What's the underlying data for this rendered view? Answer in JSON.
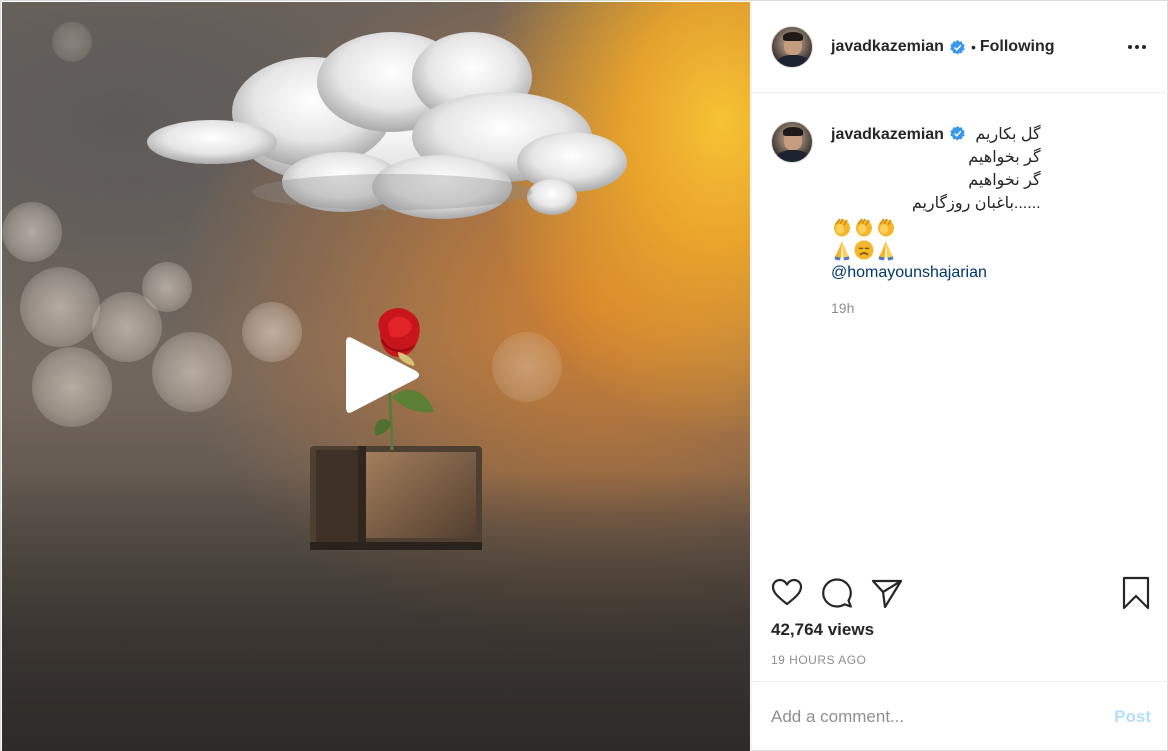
{
  "post": {
    "author": "javadkazemian",
    "verified": true,
    "follow_state": "Following",
    "separator": "•",
    "media": {
      "type": "video",
      "play_icon": "play-icon"
    },
    "caption": {
      "lines": [
        "گل بکاریم",
        "گر بخواهیم",
        "گر نخواهیم",
        "......باغبان روزگاریم"
      ],
      "emoji_rows": [
        [
          "clapping-hands",
          "clapping-hands",
          "clapping-hands"
        ],
        [
          "folded-hands",
          "disappointed-face",
          "folded-hands"
        ]
      ],
      "mention": "@homayounshajarian",
      "relative_time": "19h"
    },
    "actions": {
      "like_icon": "heart-icon",
      "comment_icon": "comment-icon",
      "share_icon": "paper-plane-icon",
      "save_icon": "bookmark-icon"
    },
    "views": "42,764 views",
    "timestamp": "19 HOURS AGO",
    "comment_box": {
      "placeholder": "Add a comment...",
      "post_label": "Post"
    },
    "colors": {
      "verified_blue": "#3897f0",
      "mention": "#00376b",
      "post_disabled": "#b2dffc",
      "muted": "#8e8e8e"
    }
  }
}
